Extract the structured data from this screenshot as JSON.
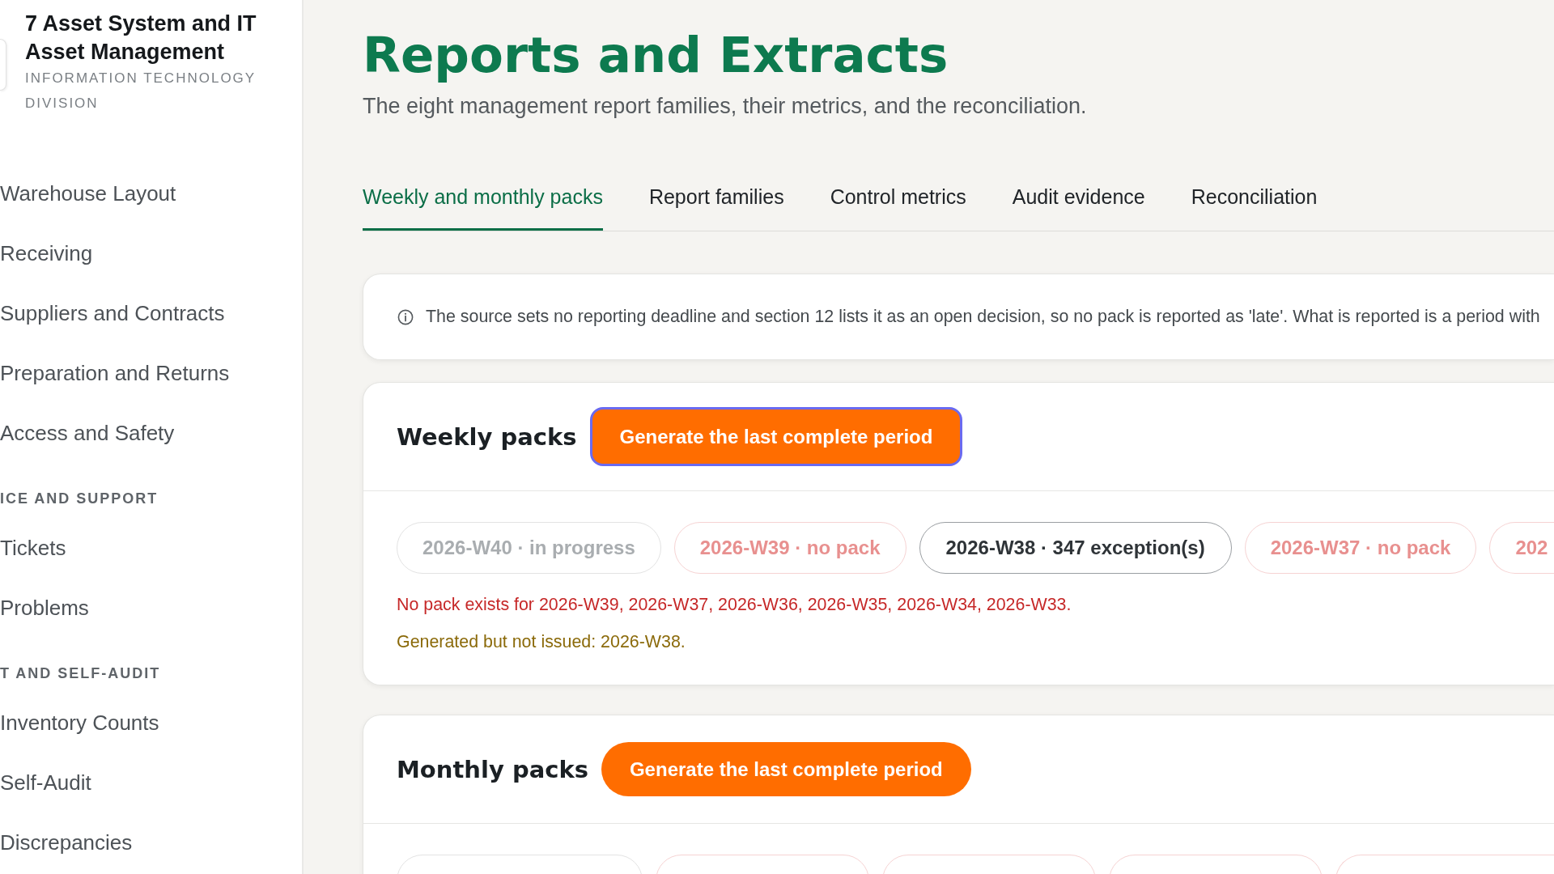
{
  "sidebar": {
    "title": "7 Asset System and IT Asset Management",
    "subtitle": "INFORMATION TECHNOLOGY DIVISION",
    "groups": [
      {
        "items": [
          {
            "label": "Warehouse Layout",
            "selected": false
          },
          {
            "label": "Receiving",
            "selected": false
          },
          {
            "label": "Suppliers and Contracts",
            "selected": false
          },
          {
            "label": "Preparation and Returns",
            "selected": false
          },
          {
            "label": "Access and Safety",
            "selected": false
          }
        ]
      },
      {
        "label": "ICE AND SUPPORT",
        "items": [
          {
            "label": "Tickets",
            "selected": false
          },
          {
            "label": "Problems",
            "selected": false
          }
        ]
      },
      {
        "label": "T AND SELF-AUDIT",
        "items": [
          {
            "label": "Inventory Counts",
            "selected": false
          },
          {
            "label": "Self-Audit",
            "selected": false
          },
          {
            "label": "Discrepancies",
            "selected": false
          }
        ]
      }
    ]
  },
  "page": {
    "title": "Reports and Extracts",
    "subtitle": "The eight management report families, their metrics, and the reconciliation."
  },
  "tabs": [
    {
      "label": "Weekly and monthly packs",
      "selected": true
    },
    {
      "label": "Report families",
      "selected": false
    },
    {
      "label": "Control metrics",
      "selected": false
    },
    {
      "label": "Audit evidence",
      "selected": false
    },
    {
      "label": "Reconciliation",
      "selected": false
    }
  ],
  "notice": {
    "text": "The source sets no reporting deadline and section 12 lists it as an open decision, so no pack is reported as 'late'. What is reported is a period with"
  },
  "sections": [
    {
      "title": "Weekly packs",
      "button": {
        "label": "Generate the last complete period",
        "focused": true
      },
      "periods": [
        {
          "label": "2026-W40 · in progress",
          "kind": "progress"
        },
        {
          "label": "2026-W39 · no pack",
          "kind": "missing"
        },
        {
          "label": "2026-W38 · 347 exception(s)",
          "kind": "exceptions"
        },
        {
          "label": "2026-W37 · no pack",
          "kind": "missing"
        },
        {
          "label": "202",
          "kind": "missing"
        }
      ],
      "notes": [
        {
          "kind": "missing",
          "text": "No pack exists for 2026-W39, 2026-W37, 2026-W36, 2026-W35, 2026-W34, 2026-W33."
        },
        {
          "kind": "unissued",
          "text": "Generated but not issued: 2026-W38."
        }
      ]
    },
    {
      "title": "Monthly packs",
      "button": {
        "label": "Generate the last complete period",
        "focused": false
      },
      "periods": [
        {
          "kind": "progress"
        },
        {
          "kind": "missing"
        },
        {
          "kind": "missing"
        },
        {
          "kind": "missing"
        },
        {
          "kind": "missing"
        }
      ]
    }
  ]
}
